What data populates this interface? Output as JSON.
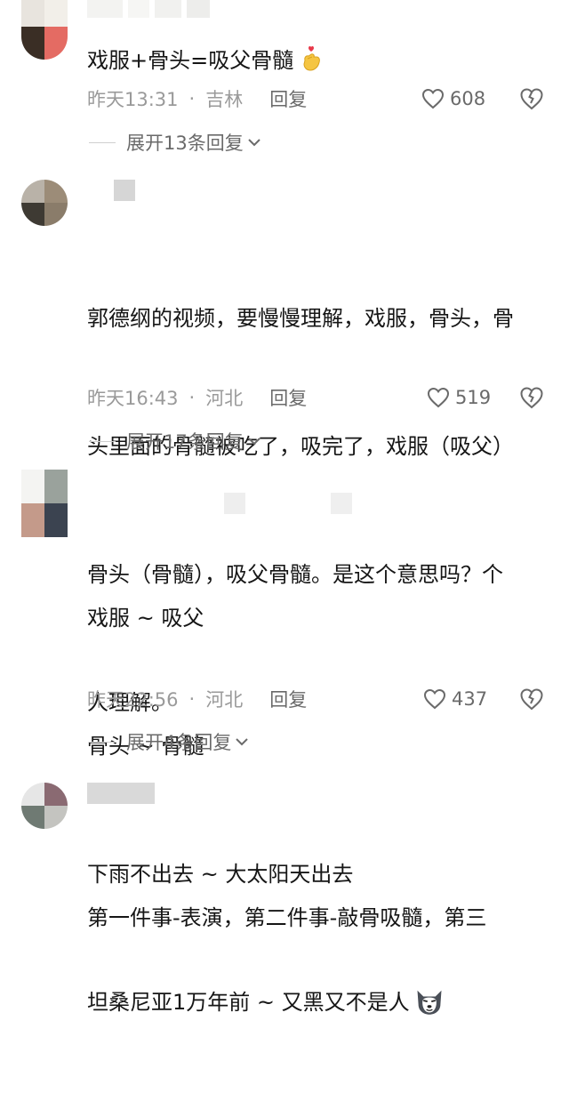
{
  "comments": [
    {
      "text": "戏服+骨头=吸父骨髓",
      "emoji": "finger-heart-emoji",
      "time": "昨天13:31",
      "location": "吉林",
      "reply_label": "回复",
      "likes": "608",
      "expand_label": "展开13条回复"
    },
    {
      "text": "郭德纲的视频，要慢慢理解，戏服，骨头，骨头里面的骨髓被吃了，吸完了，戏服（吸父）骨头（骨髓），吸父骨髓。是这个意思吗？个人理解。",
      "lines": [
        "郭德纲的视频，要慢慢理解，戏服，骨头，骨",
        "头里面的骨髓被吃了，吸完了，戏服（吸父）",
        "骨头（骨髓），吸父骨髓。是这个意思吗？个",
        "人理解。"
      ],
      "time": "昨天16:43",
      "location": "河北",
      "reply_label": "回复",
      "likes": "519",
      "expand_label": "展开17条回复"
    },
    {
      "lines": [
        "戏服 ~ 吸父",
        "骨头 ~ 骨髓",
        "下雨不出去 ~ 大太阳天出去",
        "坦桑尼亚1万年前 ~ 又黑又不是人"
      ],
      "emoji": "husky-dog-emoji",
      "time": "昨天22:56",
      "location": "河北",
      "reply_label": "回复",
      "likes": "437",
      "expand_label": "展开4条回复"
    },
    {
      "lines": [
        "第一件事-表演，第二件事-敲骨吸髓，第三"
      ]
    }
  ],
  "colors": {
    "text": "#161616",
    "meta": "#9a9a9a",
    "action": "#6a6a6a"
  },
  "icons": {
    "like": "heart-outline-icon",
    "dislike": "broken-heart-icon",
    "expand": "chevron-down-icon"
  }
}
